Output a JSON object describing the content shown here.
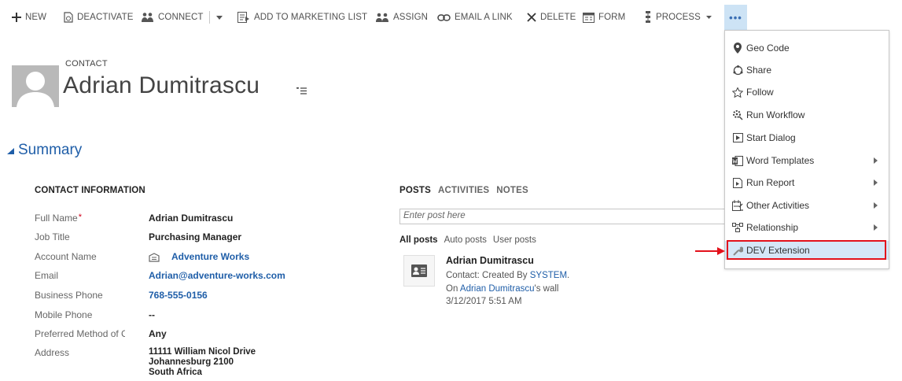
{
  "command_bar": {
    "new": "NEW",
    "deactivate": "DEACTIVATE",
    "connect": "CONNECT",
    "add_to_marketing_list": "ADD TO MARKETING LIST",
    "assign": "ASSIGN",
    "email_a_link": "EMAIL A LINK",
    "delete": "DELETE",
    "form": "FORM",
    "process": "PROCESS",
    "more": "•••"
  },
  "header": {
    "entity_label": "CONTACT",
    "record_name": "Adrian Dumitrascu"
  },
  "summary": {
    "title": "Summary",
    "section_title": "CONTACT INFORMATION",
    "fields": [
      {
        "label": "Full Name",
        "value": "Adrian Dumitrascu"
      },
      {
        "label": "Job Title",
        "value": "Purchasing Manager"
      },
      {
        "label": "Account Name",
        "value": "Adventure Works"
      },
      {
        "label": "Email",
        "value": "Adrian@adventure-works.com"
      },
      {
        "label": "Business Phone",
        "value": "768-555-0156"
      },
      {
        "label": "Mobile Phone",
        "value": "--"
      },
      {
        "label": "Preferred Method of Contact",
        "value": "Any"
      },
      {
        "label": "Address",
        "value_lines": [
          "11111 William Nicol Drive",
          "Johannesburg 2100",
          "South Africa"
        ]
      }
    ]
  },
  "social": {
    "tabs": [
      "POSTS",
      "ACTIVITIES",
      "NOTES"
    ],
    "post_placeholder": "Enter post here",
    "filters": [
      "All posts",
      "Auto posts",
      "User posts"
    ],
    "post": {
      "author": "Adrian Dumitrascu",
      "line1_prefix": "Contact: Created By ",
      "line1_link": "SYSTEM",
      "line1_suffix": ".",
      "line2_prefix": "On ",
      "line2_link": "Adrian Dumitrascu",
      "line2_suffix": "'s wall",
      "timestamp": "3/12/2017 5:51 AM"
    }
  },
  "overflow_menu": {
    "items": [
      {
        "label": "Geo Code",
        "icon": "map-pin-icon"
      },
      {
        "label": "Share",
        "icon": "share-icon"
      },
      {
        "label": "Follow",
        "icon": "star-icon"
      },
      {
        "label": "Run Workflow",
        "icon": "workflow-icon"
      },
      {
        "label": "Start Dialog",
        "icon": "dialog-icon"
      },
      {
        "label": "Word Templates",
        "icon": "word-icon",
        "submenu": true
      },
      {
        "label": "Run Report",
        "icon": "report-icon",
        "submenu": true
      },
      {
        "label": "Other Activities",
        "icon": "activities-icon",
        "submenu": true
      },
      {
        "label": "Relationship",
        "icon": "relationship-icon",
        "submenu": true
      },
      {
        "label": "DEV Extension",
        "icon": "wrench-icon",
        "highlighted": true
      }
    ]
  },
  "colors": {
    "accent_blue": "#1f5ea8",
    "highlight_red": "#e3111b",
    "menu_hover": "#d5e6f7",
    "more_button_bg": "#cde3f5"
  }
}
